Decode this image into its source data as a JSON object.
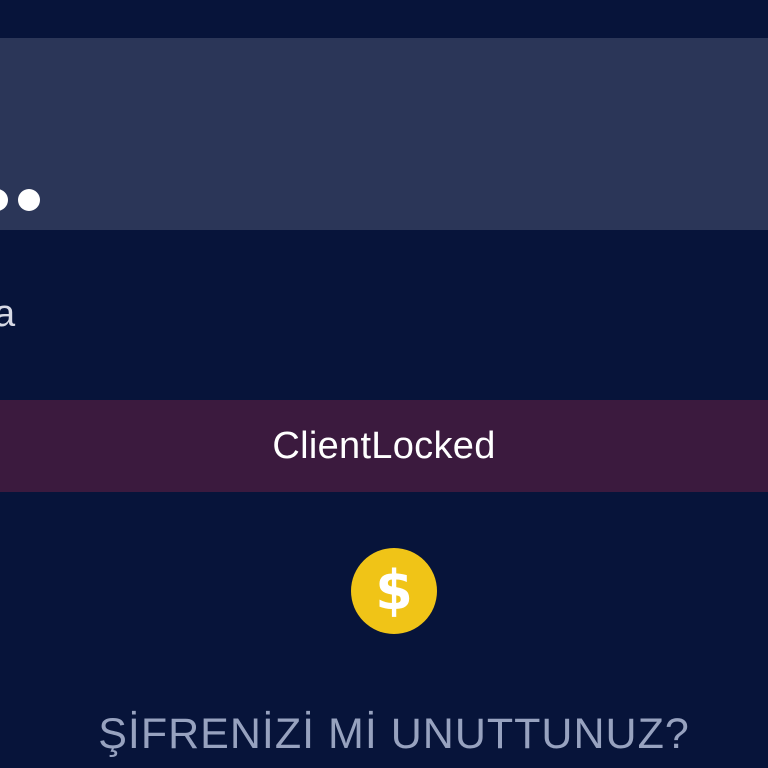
{
  "password": {
    "masked_value": "••"
  },
  "remember": {
    "label": "a"
  },
  "error": {
    "message": "ClientLocked"
  },
  "coin": {
    "icon": "dollar-coin-icon",
    "glyph": "$",
    "color": "#f0c417"
  },
  "forgot": {
    "label": "ŞİFRENİZİ Mİ UNUTTUNUZ?"
  },
  "colors": {
    "background": "#07143a",
    "field": "#2b3658",
    "error_banner": "#3b1a3e"
  }
}
